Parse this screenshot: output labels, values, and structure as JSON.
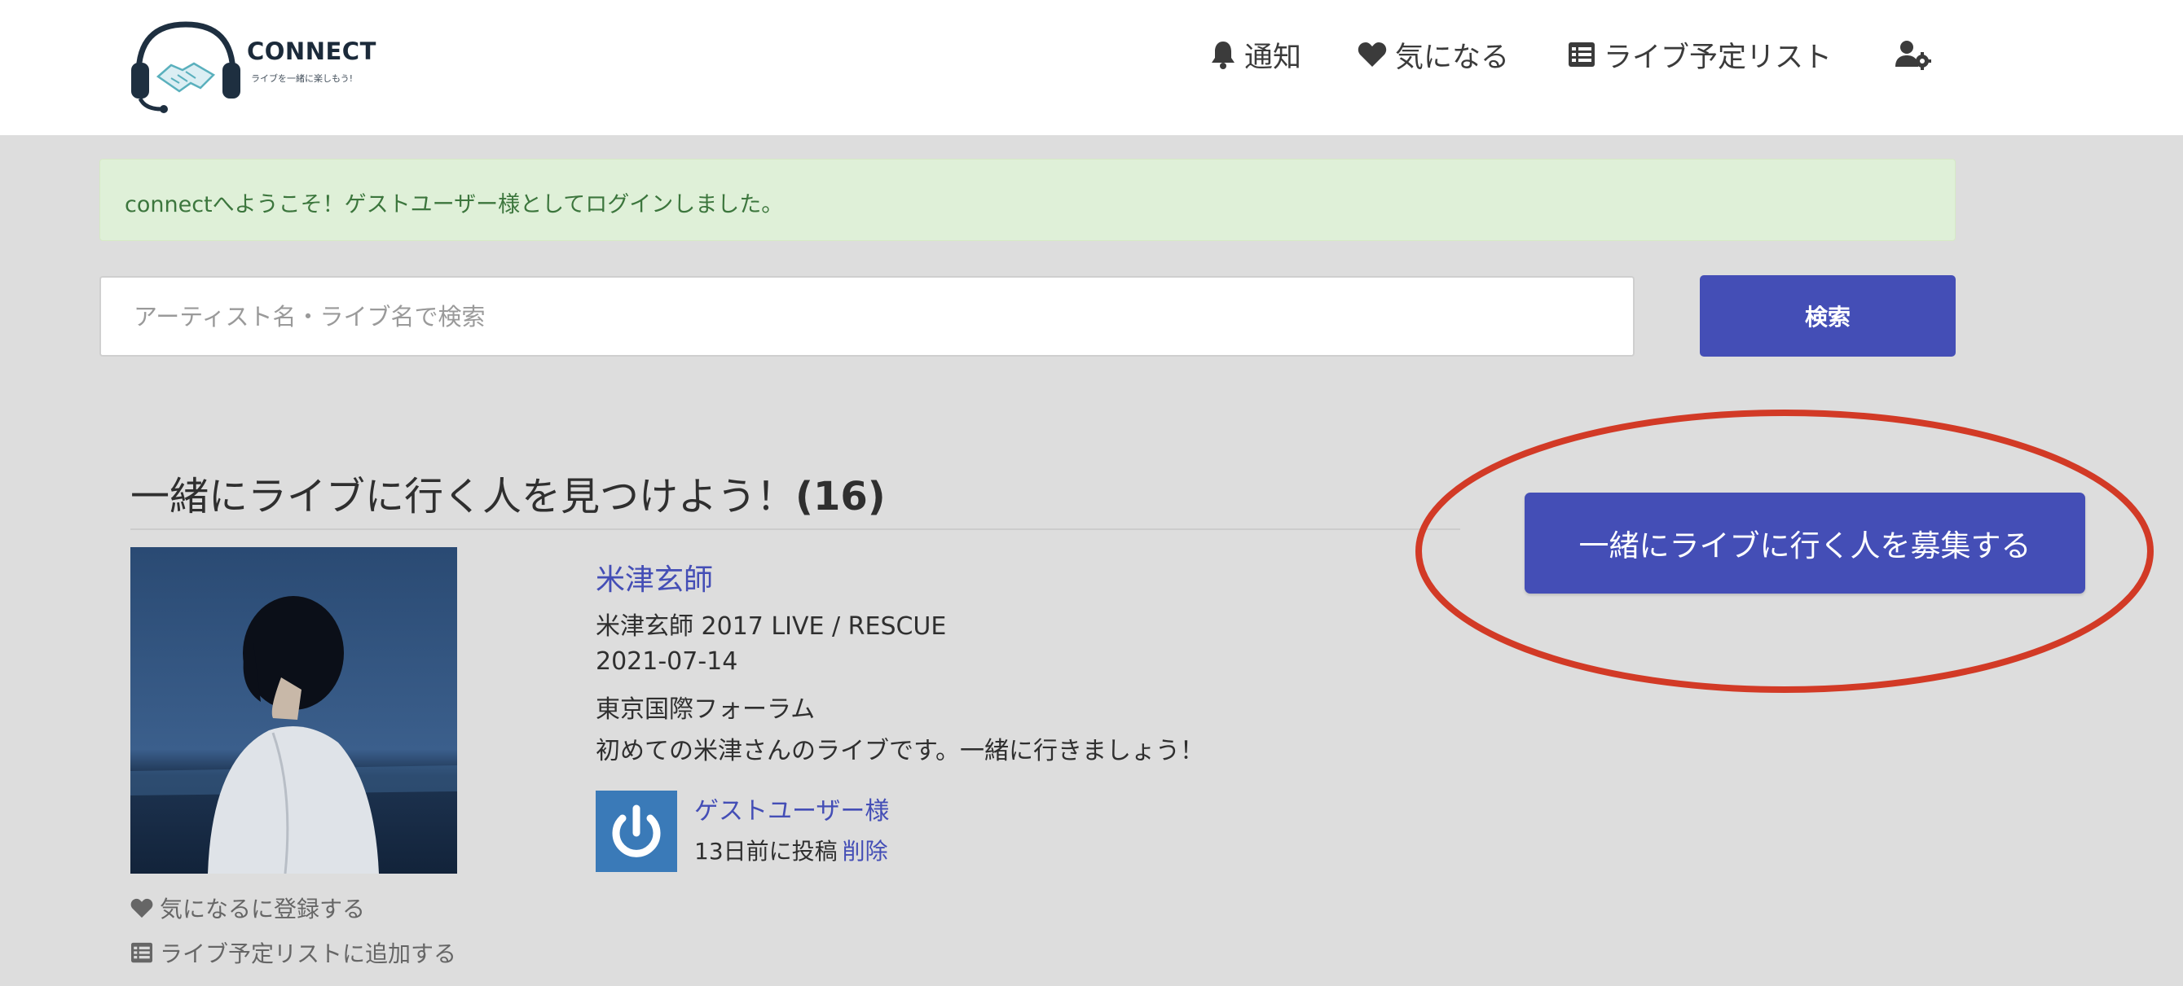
{
  "header": {
    "logo_text": "CONNECT",
    "logo_tagline": "ライブを一緒に楽しもう!",
    "nav": {
      "notifications_label": "通知",
      "favorites_label": "気になる",
      "schedule_label": "ライブ予定リスト",
      "account_icon": "user-gear-icon"
    }
  },
  "alert": {
    "message": "connectへようこそ！ゲストユーザー様としてログインしました。"
  },
  "search": {
    "placeholder": "アーティスト名・ライブ名で検索",
    "button_label": "検索"
  },
  "section": {
    "title": "一緒にライブに行く人を見つけよう！",
    "count": "(16)",
    "recruit_button_label": "一緒にライブに行く人を募集する"
  },
  "post": {
    "artist": "米津玄師",
    "live_title": "米津玄師 2017 LIVE / RESCUE",
    "date": "2021-07-14",
    "venue": "東京国際フォーラム",
    "comment": "初めての米津さんのライブです。一緒に行きましょう！",
    "favorite_link": "気になるに登録する",
    "schedule_link": "ライブ予定リストに追加する",
    "user_name": "ゲストユーザー様",
    "posted_ago": "13日前に投稿",
    "delete_label": "削除"
  },
  "colors": {
    "accent": "#444eb6",
    "background": "#dddddd",
    "alert_bg": "#dff0d8",
    "alert_text": "#3c763d",
    "annotation": "#d23a26"
  }
}
